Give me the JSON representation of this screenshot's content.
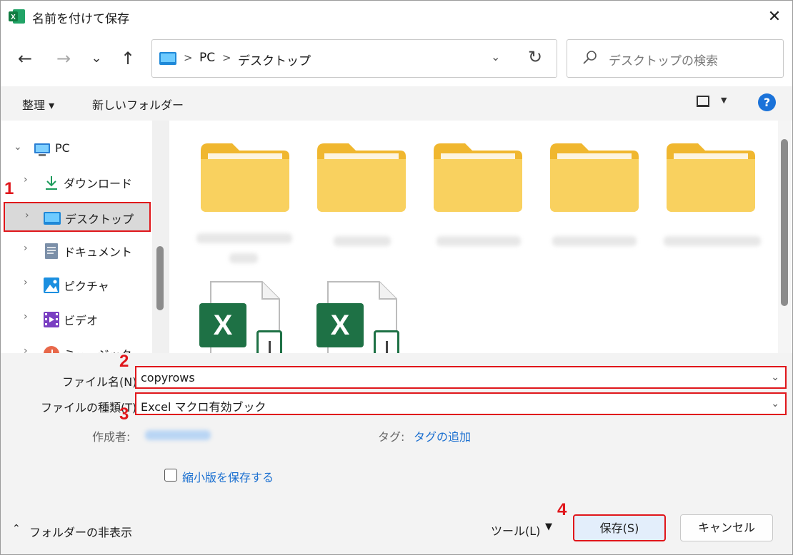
{
  "window": {
    "title": "名前を付けて保存"
  },
  "nav": {
    "back_glyph": "←",
    "forward_glyph": "→",
    "recent_glyph": "⌄",
    "up_glyph": "↑",
    "address": {
      "root": "PC",
      "current": "デスクトップ",
      "sep": ">"
    },
    "refresh_glyph": "↻",
    "search_placeholder": "デスクトップの検索"
  },
  "commands": {
    "organize": "整理 ▾",
    "new_folder": "新しいフォルダー",
    "help": "?"
  },
  "sidebar": {
    "root": "PC",
    "items": [
      {
        "label": "ダウンロード",
        "icon": "download-icon"
      },
      {
        "label": "デスクトップ",
        "icon": "desktop-icon"
      },
      {
        "label": "ドキュメント",
        "icon": "document-icon"
      },
      {
        "label": "ピクチャ",
        "icon": "pictures-icon"
      },
      {
        "label": "ビデオ",
        "icon": "video-icon"
      },
      {
        "label": "ミュージック",
        "icon": "music-icon"
      }
    ]
  },
  "files": {
    "folder_count_visible": 5,
    "excel_count_visible": 2,
    "excel_letter": "X"
  },
  "form": {
    "filename_label": "ファイル名(N):",
    "filename_value": "copyrows",
    "filetype_label": "ファイルの種類(T):",
    "filetype_value": "Excel マクロ有効ブック",
    "author_label": "作成者:",
    "tags_label": "タグ:",
    "tags_link": "タグの追加",
    "thumbnail_label": "縮小版を保存する"
  },
  "footer": {
    "hide_folders": "フォルダーの非表示",
    "tools": "ツール(L)",
    "save": "保存(S)",
    "cancel": "キャンセル"
  },
  "steps": [
    "1",
    "2",
    "3",
    "4"
  ],
  "colors": {
    "accent": "#1a72d9",
    "highlight": "#e0161b",
    "folder": "#f7c94b",
    "excel": "#1e7145"
  }
}
